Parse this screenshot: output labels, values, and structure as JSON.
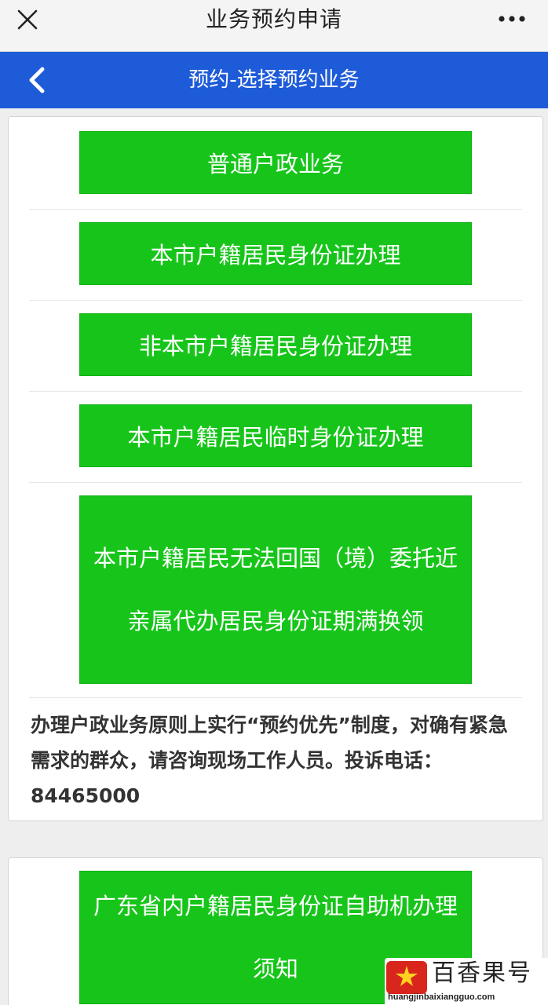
{
  "topbar": {
    "title": "业务预约申请",
    "close_icon": "close-icon",
    "more_icon": "more-icon"
  },
  "header": {
    "title": "预约-选择预约业务",
    "back_icon": "chevron-left-icon",
    "color": "#1e5bd8"
  },
  "services": [
    {
      "label": "普通户政业务"
    },
    {
      "label": "本市户籍居民身份证办理"
    },
    {
      "label": "非本市户籍居民身份证办理"
    },
    {
      "label": "本市户籍居民临时身份证办理"
    },
    {
      "label": "本市户籍居民无法回国（境）委托近亲属代办居民身份证期满换领"
    }
  ],
  "note": "办理户政业务原则上实行“预约优先”制度，对确有紧急需求的群众，请咨询现场工作人员。投诉电话：84465000",
  "services2": [
    {
      "label": "广东省内户籍居民身份证自助机办理须知"
    }
  ],
  "watermark": {
    "brand": "百香果号",
    "domain": "huangjinbaixiangguo.com"
  },
  "colors": {
    "button_green": "#17c51a",
    "header_blue": "#1e5bd8"
  }
}
